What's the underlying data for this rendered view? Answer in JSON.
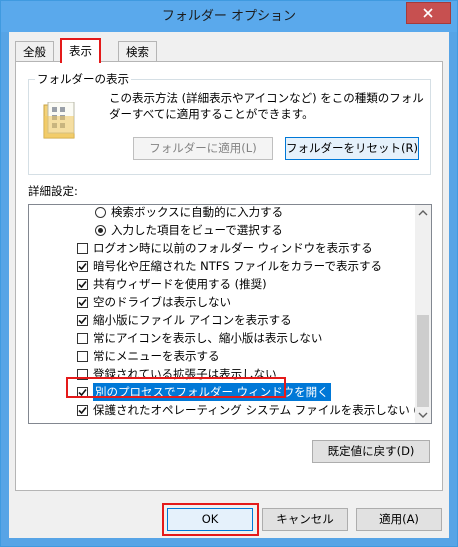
{
  "window": {
    "title": "フォルダー オプション"
  },
  "tabs": [
    {
      "label": "全般"
    },
    {
      "label": "表示"
    },
    {
      "label": "検索"
    }
  ],
  "folder_views": {
    "legend": "フォルダーの表示",
    "description": "この表示方法 (詳細表示やアイコンなど) をこの種類のフォルダーすべてに適用することができます。",
    "apply_button": "フォルダーに適用(L)",
    "reset_button": "フォルダーをリセット(R)"
  },
  "advanced": {
    "label": "詳細設定:",
    "items": [
      {
        "type": "radio",
        "checked": false,
        "label": "検索ボックスに自動的に入力する"
      },
      {
        "type": "radio",
        "checked": true,
        "label": "入力した項目をビューで選択する"
      },
      {
        "type": "checkbox",
        "checked": false,
        "label": "ログオン時に以前のフォルダー ウィンドウを表示する"
      },
      {
        "type": "checkbox",
        "checked": true,
        "label": "暗号化や圧縮された NTFS ファイルをカラーで表示する"
      },
      {
        "type": "checkbox",
        "checked": true,
        "label": "共有ウィザードを使用する (推奨)"
      },
      {
        "type": "checkbox",
        "checked": true,
        "label": "空のドライブは表示しない"
      },
      {
        "type": "checkbox",
        "checked": true,
        "label": "縮小版にファイル アイコンを表示する"
      },
      {
        "type": "checkbox",
        "checked": false,
        "label": "常にアイコンを表示し、縮小版は表示しない"
      },
      {
        "type": "checkbox",
        "checked": false,
        "label": "常にメニューを表示する"
      },
      {
        "type": "checkbox",
        "checked": false,
        "label": "登録されている拡張子は表示しない"
      },
      {
        "type": "checkbox",
        "checked": true,
        "label": "別のプロセスでフォルダー ウィンドウを開く"
      },
      {
        "type": "checkbox",
        "checked": true,
        "label": "保護されたオペレーティング システム ファイルを表示しない (推奨)"
      }
    ]
  },
  "restore_button": "既定値に戻す(D)",
  "footer": {
    "ok": "OK",
    "cancel": "キャンセル",
    "apply": "適用(A)"
  },
  "colors": {
    "selection": "#0078d7",
    "annotation_red": "#e41a1a",
    "titlebar": "#5aa9ec",
    "close_button": "#c75050"
  }
}
